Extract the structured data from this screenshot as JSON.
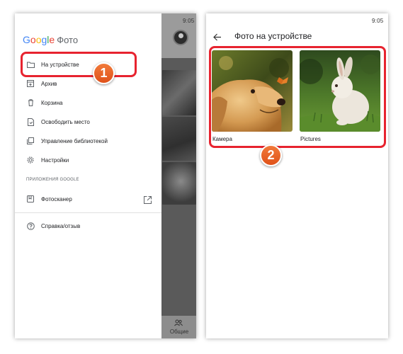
{
  "left_phone": {
    "status_time": "9:05",
    "logo": {
      "google": "Google",
      "product": "Фото"
    },
    "menu": [
      {
        "label": "На устройстве",
        "icon": "folder-icon"
      },
      {
        "label": "Архив",
        "icon": "archive-icon"
      },
      {
        "label": "Корзина",
        "icon": "trash-icon"
      },
      {
        "label": "Освободить место",
        "icon": "free-space-icon"
      },
      {
        "label": "Управление библиотекой",
        "icon": "library-icon"
      },
      {
        "label": "Настройки",
        "icon": "gear-icon"
      }
    ],
    "section_header": "ПРИЛОЖЕНИЯ GOOGLE",
    "apps": [
      {
        "label": "Фотосканер",
        "icon": "photoscan-icon",
        "action_icon": "open-external-icon"
      }
    ],
    "help": {
      "label": "Справка/отзыв",
      "icon": "help-icon"
    },
    "background_tab": {
      "label": "Общие",
      "icon": "people-icon"
    }
  },
  "right_phone": {
    "status_time": "9:05",
    "title": "Фото на устройстве",
    "folders": [
      {
        "label": "Камера",
        "image": "dog-with-butterfly"
      },
      {
        "label": "Pictures",
        "image": "white-rabbit-on-grass"
      }
    ]
  },
  "annotations": {
    "step1": "1",
    "step2": "2",
    "highlight_color": "#e7232f",
    "badge_color": "#e8612a"
  }
}
